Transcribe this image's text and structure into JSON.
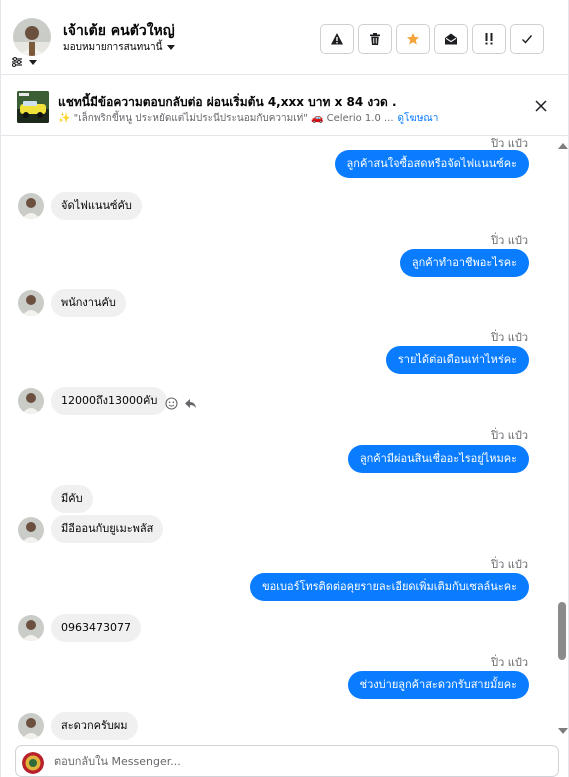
{
  "header": {
    "contact_name": "เจ้าเต้ย คนตัวใหญ่",
    "assign_label": "มอบหมายการสนทนานี้",
    "actions": [
      "spam-icon",
      "trash-icon",
      "star-icon",
      "mark-unread-icon",
      "important-icon",
      "check-icon"
    ],
    "star_color": "#f7b928"
  },
  "ad": {
    "title": "แชทนี้มีข้อความตอบกลับต่อ ผ่อนเริ่มต้น 4,xxx บาท x 84 งวด .",
    "subtitle": "✨ \"เล็กพริกขี้หนู ประหยัดแต่ไม่ประนีประนอมกับความเท่\" 🚗 Celerio 1.0 ...",
    "link": "ดูโฆษณา"
  },
  "messages": {
    "m1": {
      "sender": "ปิ่ว แป๋ว",
      "text": "ลูกค้าสนใจซื้อสดหรือจัดไฟแนนซ์คะ"
    },
    "m2": {
      "text": "จัดไฟแนนซ์คับ"
    },
    "m3": {
      "sender": "ปิ่ว แป๋ว",
      "text": "ลูกค้าทำอาชีพอะไรคะ"
    },
    "m4": {
      "text": "พนักงานคับ"
    },
    "m5": {
      "sender": "ปิ่ว แป๋ว",
      "text": "รายได้ต่อเดือนเท่าไหร่คะ"
    },
    "m6": {
      "text": "12000ถึง13000คับ"
    },
    "m7": {
      "sender": "ปิ่ว แป๋ว",
      "text": "ลูกค้ามีผ่อนสินเชื่ออะไรอยู่ไหมคะ"
    },
    "m8": {
      "text": "มีคับ"
    },
    "m9": {
      "text": "มีอีออนกับยูเมะพลัส"
    },
    "m10": {
      "sender": "ปิ่ว แป๋ว",
      "text": "ขอเบอร์โทรติดต่อคุยรายละเอียดเพิ่มเติมกับเซลล์นะคะ"
    },
    "m11": {
      "text": "0963473077"
    },
    "m12": {
      "sender": "ปิ่ว แป๋ว",
      "text": "ช่วงบ่ายลูกค้าสะดวกรับสายมั้ยคะ"
    },
    "m13": {
      "text": "สะดวกครับผม"
    }
  },
  "composer": {
    "placeholder": "ตอบกลับใน Messenger..."
  },
  "colors": {
    "outgoing_bubble": "#0a7cff",
    "incoming_bubble": "#f0f0f0"
  }
}
